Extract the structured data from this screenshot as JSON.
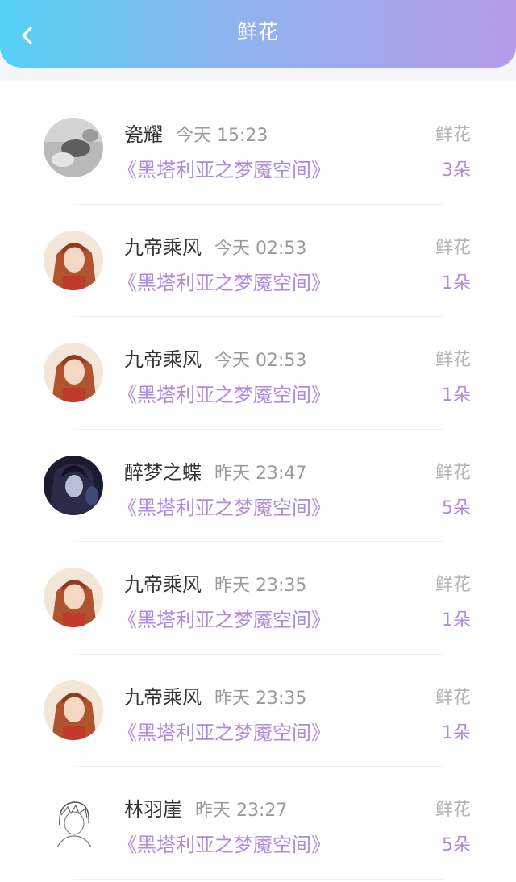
{
  "header": {
    "title": "鲜花",
    "back_icon": "chevron-left-icon",
    "gradient_start": "#56d1f6",
    "gradient_end": "#b79be8"
  },
  "items": [
    {
      "name": "瓷耀",
      "time": "今天 15:23",
      "book": "《黑塔利亚之梦魇空间》",
      "label": "鲜花",
      "count": "3朵",
      "avatar": "grey-photo"
    },
    {
      "name": "九帝乘风",
      "time": "今天 02:53",
      "book": "《黑塔利亚之梦魇空间》",
      "label": "鲜花",
      "count": "1朵",
      "avatar": "anime-red-hair"
    },
    {
      "name": "九帝乘风",
      "time": "今天 02:53",
      "book": "《黑塔利亚之梦魇空间》",
      "label": "鲜花",
      "count": "1朵",
      "avatar": "anime-red-hair"
    },
    {
      "name": "醉梦之蝶",
      "time": "昨天 23:47",
      "book": "《黑塔利亚之梦魇空间》",
      "label": "鲜花",
      "count": "5朵",
      "avatar": "anime-dark-hair"
    },
    {
      "name": "九帝乘风",
      "time": "昨天 23:35",
      "book": "《黑塔利亚之梦魇空间》",
      "label": "鲜花",
      "count": "1朵",
      "avatar": "anime-red-hair"
    },
    {
      "name": "九帝乘风",
      "time": "昨天 23:35",
      "book": "《黑塔利亚之梦魇空间》",
      "label": "鲜花",
      "count": "1朵",
      "avatar": "anime-red-hair"
    },
    {
      "name": "林羽崖",
      "time": "昨天 23:27",
      "book": "《黑塔利亚之梦魇空间》",
      "label": "鲜花",
      "count": "5朵",
      "avatar": "sketch-portrait"
    }
  ],
  "colors": {
    "accent_purple": "#b08ae0",
    "name_text": "#333333",
    "muted_text": "#9a9a9a"
  }
}
